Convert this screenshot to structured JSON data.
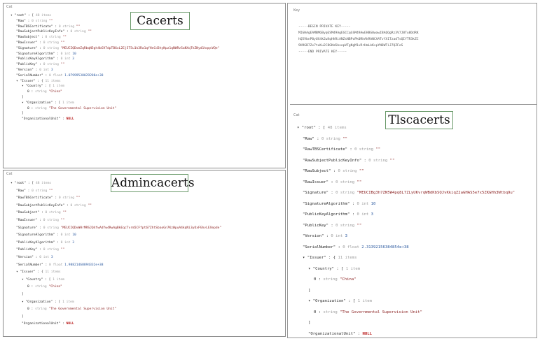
{
  "panels": {
    "cacerts": {
      "label": "Cat",
      "title": "Cacerts",
      "lines": [
        {
          "d": 0,
          "k": "▾ \"root\" : [",
          "t": "48 items"
        },
        {
          "d": 1,
          "k": "\"Raw\"",
          "t": "0 string",
          "v": "\"\""
        },
        {
          "d": 1,
          "k": "\"RawTBSCertificate\"",
          "t": "0 string",
          "v": "\"\""
        },
        {
          "d": 1,
          "k": "\"RawSubjectPublicKeyInfo\"",
          "t": "0 string",
          "v": "\"\""
        },
        {
          "d": 1,
          "k": "\"RawSubject\"",
          "t": "0 string",
          "v": "\"\""
        },
        {
          "d": 1,
          "k": "\"RawIssuer\"",
          "t": "0 string",
          "v": "\"\""
        },
        {
          "d": 1,
          "k": "\"Signature\"",
          "t": "0 string",
          "v": "\"MEUCIQDvmZqRbqN5gh4bGV7dpTB6xL2Ej5T5u1k3Ra1qfHnCd3hyNpz1qNWRvSaNXqTkZNyd1hqqsVQe\""
        },
        {
          "d": 1,
          "k": "\"SignatureAlgorithm\"",
          "t": "0 int",
          "v": "10"
        },
        {
          "d": 1,
          "k": "\"PublicKeyAlgorithm\"",
          "t": "0 int",
          "v": "3"
        },
        {
          "d": 1,
          "k": "\"PublicKey\"",
          "t": "0 string",
          "v": "\"\""
        },
        {
          "d": 1,
          "k": "\"Version\"",
          "t": "0 int",
          "v": "3"
        },
        {
          "d": 1,
          "k": "\"SerialNumber\"",
          "t": "0 float",
          "v": "1.07999538029288e+38"
        },
        {
          "d": 1,
          "k": "▾ \"Issuer\" : {",
          "t": "11 items"
        },
        {
          "d": 2,
          "k": "▾ \"Country\" : [",
          "t": "1 item"
        },
        {
          "d": 3,
          "k": "0 :",
          "t": "string",
          "v": "\"China\""
        },
        {
          "d": 2,
          "k": "]"
        },
        {
          "d": 2,
          "k": "▾ \"Organization\" : [",
          "t": "1 item"
        },
        {
          "d": 3,
          "k": "0 :",
          "t": "string",
          "v": "\"The Governmental Supervision Unit\""
        },
        {
          "d": 2,
          "k": "]"
        },
        {
          "d": 2,
          "k": "\"OrganizationalUnit\" :",
          "v": "NULL",
          "nul": true
        }
      ]
    },
    "admincacerts": {
      "label": "Cat",
      "title": "Admincacerts",
      "lines": [
        {
          "d": 0,
          "k": "▾ \"root\" : [",
          "t": "48 items"
        },
        {
          "d": 1,
          "k": "\"Raw\"",
          "t": "0 string",
          "v": "\"\""
        },
        {
          "d": 1,
          "k": "\"RawTBSCertificate\"",
          "t": "0 string",
          "v": "\"\""
        },
        {
          "d": 1,
          "k": "\"RawSubjectPublicKeyInfo\"",
          "t": "0 string",
          "v": "\"\""
        },
        {
          "d": 1,
          "k": "\"RawSubject\"",
          "t": "0 string",
          "v": "\"\""
        },
        {
          "d": 1,
          "k": "\"RawIssuer\"",
          "t": "0 string",
          "v": "\"\""
        },
        {
          "d": 1,
          "k": "\"Signature\"",
          "t": "0 string",
          "v": "\"MEUCIQDvWHrMRSJQ4fwAdYw4RwAgBkEqcTvrm5CFfpt67ZhtSbaoGn7KzWpuA4kqNi3yOxFGhvLEXepde\""
        },
        {
          "d": 1,
          "k": "\"SignatureAlgorithm\"",
          "t": "0 int",
          "v": "10"
        },
        {
          "d": 1,
          "k": "\"PublicKeyAlgorithm\"",
          "t": "0 int",
          "v": "3"
        },
        {
          "d": 1,
          "k": "\"PublicKey\"",
          "t": "0 string",
          "v": "\"\""
        },
        {
          "d": 1,
          "k": "\"Version\"",
          "t": "0 int",
          "v": "3"
        },
        {
          "d": 1,
          "k": "\"SerialNumber\"",
          "t": "0 float",
          "v": "1.98821468894332e+38"
        },
        {
          "d": 1,
          "k": "▾ \"Issuer\" : {",
          "t": "11 items"
        },
        {
          "d": 2,
          "k": "▾ \"Country\" : [",
          "t": "1 item"
        },
        {
          "d": 3,
          "k": "0 :",
          "t": "string",
          "v": "\"China\""
        },
        {
          "d": 2,
          "k": "]"
        },
        {
          "d": 2,
          "k": "▾ \"Organization\" : [",
          "t": "1 item"
        },
        {
          "d": 3,
          "k": "0 :",
          "t": "string",
          "v": "\"The Governmental Supervision Unit\""
        },
        {
          "d": 2,
          "k": "]"
        },
        {
          "d": 2,
          "k": "\"OrganizationalUnit\" :",
          "v": "NULL",
          "nul": true
        }
      ]
    },
    "key": {
      "label": "Key",
      "lines": [
        "-----BEGIN PRIVATE KEY-----",
        "MIGHAgEAMBMGByqGSM49AgEGCCqGSM49AwEHBG0wawIBAQQgRz3V7J8Tu8DdRK",
        "hQ5VbnP0yUX4k2wXqHhRiANZsNBPoPk0RhAhRANCAATvYX1TzadTsQIfTR3kZC",
        "9H9GB7Zx7tuKu2C8GKm5bxepVTgNgM1vRrHmLkKvpYN8WTiJ7QZFeS",
        "-----END PRIVATE KEY-----"
      ]
    },
    "tlscacerts": {
      "label": "Cat",
      "title": "Tlscacerts",
      "lines": [
        {
          "d": 0,
          "k": "▾ \"root\" : [",
          "t": "48 items"
        },
        {
          "d": 1,
          "k": "\"Raw\"",
          "t": "0 string",
          "v": "\"\""
        },
        {
          "d": 1,
          "k": "\"RawTBSCertificate\"",
          "t": "0 string",
          "v": "\"\""
        },
        {
          "d": 1,
          "k": "\"RawSubjectPublicKeyInfo\"",
          "t": "0 string",
          "v": "\"\""
        },
        {
          "d": 1,
          "k": "\"RawSubject\"",
          "t": "0 string",
          "v": "\"\""
        },
        {
          "d": 1,
          "k": "\"RawIssuer\"",
          "t": "0 string",
          "v": "\"\""
        },
        {
          "d": 1,
          "k": "\"Signature\"",
          "t": "0 string",
          "v": "\"MEUCIBg3h7ZN5W4pq8L7ZLyUKvrqWBdKbSQJvKkiqZ2aGHAS5e7x5ZKGHh3Wtbq9u\""
        },
        {
          "d": 1,
          "k": "\"SignatureAlgorithm\"",
          "t": "0 int",
          "v": "10"
        },
        {
          "d": 1,
          "k": "\"PublicKeyAlgorithm\"",
          "t": "0 int",
          "v": "3"
        },
        {
          "d": 1,
          "k": "\"PublicKey\"",
          "t": "0 string",
          "v": "\"\""
        },
        {
          "d": 1,
          "k": "\"Version\"",
          "t": "0 int",
          "v": "3"
        },
        {
          "d": 1,
          "k": "\"SerialNumber\"",
          "t": "0 float",
          "v": "2.31392156384854e+38"
        },
        {
          "d": 1,
          "k": "▾ \"Issuer\" : {",
          "t": "11 items"
        },
        {
          "d": 2,
          "k": "▾ \"Country\" : [",
          "t": "1 item"
        },
        {
          "d": 3,
          "k": "0 :",
          "t": "string",
          "v": "\"China\""
        },
        {
          "d": 2,
          "k": "]"
        },
        {
          "d": 2,
          "k": "▾ \"Organization\" : [",
          "t": "1 item"
        },
        {
          "d": 3,
          "k": "0 :",
          "t": "string",
          "v": "\"The Governmental Supervision Unit\""
        },
        {
          "d": 2,
          "k": "]"
        },
        {
          "d": 2,
          "k": "\"OrganizationalUnit\" :",
          "v": "NULL",
          "nul": true
        }
      ]
    }
  }
}
